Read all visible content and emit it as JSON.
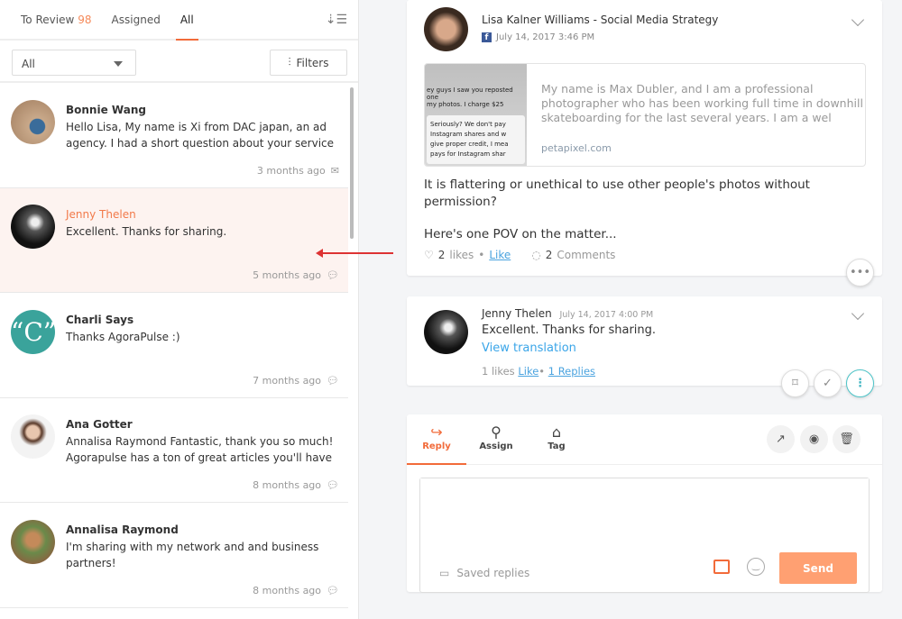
{
  "tabs": {
    "to_review": "To Review",
    "to_review_count": "98",
    "assigned": "Assigned",
    "all": "All"
  },
  "filter": {
    "select_value": "All",
    "filters_label": "Filters"
  },
  "list": [
    {
      "name": "Bonnie Wang",
      "text": "Hello Lisa, My name is Xi from DAC japan, an ad agency. I had a short question about your service",
      "time": "3 months ago",
      "icon": "mail-icon"
    },
    {
      "name": "Jenny Thelen",
      "text": "Excellent. Thanks for sharing.",
      "time": "5 months ago",
      "icon": "comment-icon"
    },
    {
      "name": "Charli Says",
      "text": "Thanks AgoraPulse :)",
      "time": "7 months ago",
      "icon": "comment-icon"
    },
    {
      "name": "Ana Gotter",
      "text": "Annalisa Raymond Fantastic, thank you so much! Agorapulse has a ton of great articles you'll have",
      "time": "8 months ago",
      "icon": "comment-icon"
    },
    {
      "name": "Annalisa Raymond",
      "text": "I'm sharing with my network and and business partners!",
      "time": "8 months ago",
      "icon": "comment-icon"
    }
  ],
  "post": {
    "author": "Lisa Kalner Williams - Social Media Strategy",
    "date": "July 14, 2017 3:46 PM",
    "link_thumb": {
      "l1": "ey guys I saw you reposted one",
      "l2": "my photos. I charge $25",
      "l3": "Seriously? We don't pay Instagram shares and w give proper credit, I mea pays for Instagram shar"
    },
    "link_text": "My name is Max Dubler, and I am a professional photographer who has been working full time in downhill skateboarding for the last several years. I am a wel",
    "link_source": "petapixel.com",
    "text1": "It is flattering or unethical to use other people's photos without permission?",
    "text2": "Here's one POV on the matter...",
    "likes_count": "2",
    "likes_label": "likes",
    "like_link": "Like",
    "comments_count": "2",
    "comments_label": "Comments"
  },
  "comment": {
    "author": "Jenny Thelen",
    "date": "July 14, 2017 4:00 PM",
    "text": "Excellent. Thanks for sharing.",
    "translate": "View translation",
    "likes": "1 likes",
    "like_link": "Like",
    "replies": "1 Replies"
  },
  "reply": {
    "tabs": [
      "Reply",
      "Assign",
      "Tag"
    ],
    "saved_replies": "Saved replies",
    "send": "Send",
    "message_value": ""
  },
  "colors": {
    "accent": "#f26b3a",
    "link": "#4aa3df",
    "send": "#ffa072",
    "selected_row": "#fdf3f0"
  }
}
